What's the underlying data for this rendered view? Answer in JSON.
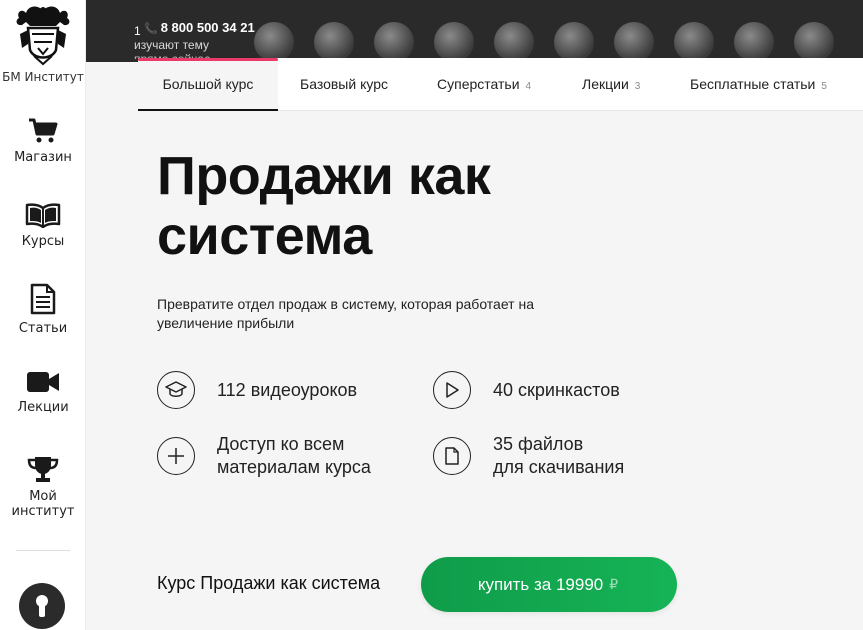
{
  "sidebar": {
    "logo_label": "БМ Институт",
    "items": [
      {
        "label": "Магазин",
        "icon": "cart-icon"
      },
      {
        "label": "Курсы",
        "icon": "book-icon"
      },
      {
        "label": "Статьи",
        "icon": "document-icon"
      },
      {
        "label": "Лекции",
        "icon": "video-camera-icon"
      },
      {
        "label": "Мой институт",
        "icon": "trophy-icon"
      }
    ],
    "bottom_button_icon": "keyhole-icon"
  },
  "header": {
    "phone": "8 800 500 34 21",
    "students_count": "1",
    "students_text": "изучают тему",
    "students_text_line3": "прямо сейчас"
  },
  "tabs": [
    {
      "label": "Большой курс",
      "count": ""
    },
    {
      "label": "Базовый курс",
      "count": ""
    },
    {
      "label": "Суперстатьи",
      "count": "4"
    },
    {
      "label": "Лекции",
      "count": "3"
    },
    {
      "label": "Бесплатные статьи",
      "count": "5"
    }
  ],
  "main": {
    "title_line1": "Продажи как",
    "title_line2": "система",
    "subtitle": "Превратите отдел продаж в систему, которая работает на увеличение прибыли",
    "features": [
      {
        "icon": "graduation-cap-icon",
        "line1": "112 видеоуроков",
        "line2": ""
      },
      {
        "icon": "play-icon",
        "line1": "40 скринкастов",
        "line2": ""
      },
      {
        "icon": "plus-icon",
        "line1": "Доступ ко всем",
        "line2": "материалам курса"
      },
      {
        "icon": "file-icon",
        "line1": "35 файлов",
        "line2": "для скачивания"
      }
    ],
    "buy_label": "Курс Продажи как система",
    "buy_button": "купить за 19990",
    "buy_currency": "₽"
  },
  "colors": {
    "accent_pink": "#ea3a6a",
    "button_green": "#13a851",
    "header_dark": "#2a2a2a"
  }
}
